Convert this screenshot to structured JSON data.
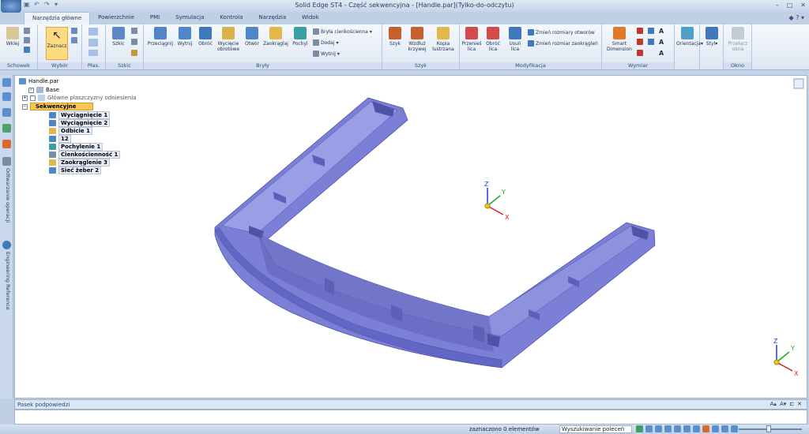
{
  "window": {
    "title": "Solid Edge ST4 - Część sekwencyjna - [Handle.par](Tylko-do-odczytu)",
    "controls": [
      "–",
      "□",
      "✕"
    ]
  },
  "tabs": [
    {
      "label": "Narzędzia główne",
      "active": true
    },
    {
      "label": "Powierzchnie"
    },
    {
      "label": "PMI"
    },
    {
      "label": "Symulacja"
    },
    {
      "label": "Kontrola"
    },
    {
      "label": "Narzędzia"
    },
    {
      "label": "Widok"
    }
  ],
  "ribbon": {
    "groups": {
      "schowek": "Schowek",
      "wybor": "Wybór",
      "plas": "Płas.",
      "szkic": "Szkic",
      "bryly": "Bryły",
      "szyk": "Szyk",
      "modyfikacja": "Modyfikacja",
      "wymiar": "Wymiar",
      "okno": "Okno"
    },
    "buttons": {
      "wklej": "Wklej",
      "zaznacz": "Zaznacz",
      "szkic": "Szkic",
      "przeciagnij": "Przeciągnij",
      "wytnij": "Wytnij",
      "obroc": "Obróć",
      "wyciecie_obrotowe": "Wycięcie obrotowe",
      "otwor": "Otwór",
      "zaokraglaj": "Zaokrąglaj",
      "pochyl": "Pochyl",
      "bryla_cienkoscienna": "Bryła cienkościenna",
      "dodaj": "Dodaj",
      "wytnij_small": "Wytnij",
      "szyk": "Szyk",
      "wzdluz_krzywej": "Wzdłuż krzywej",
      "kopia_lustrzana": "Kopia lustrzana",
      "przenies_lica": "Przenieś lica",
      "obroc_lica": "Obróć lica",
      "usun_lica": "Usuń lica",
      "zmien_rozmiary_otworow": "Zmień rozmiary otworów",
      "zmien_rozmiar_zaokraglen": "Zmień rozmiar zaokrągleń",
      "smart_dimension": "Smart Dimension",
      "orientacja": "Orientacja",
      "styl": "Styl",
      "przelacz_okna": "Przełącz okna"
    }
  },
  "nav_tabs": {
    "odtwarzanie": "Odtwarzanie operacji",
    "engineering": "Engineering Reference"
  },
  "tree": {
    "root": "Handle.par",
    "base": "Base",
    "plaszczyzny": "Główne płaszczyzny odniesienia",
    "sekwencyjne": "Sekwencyjne",
    "features": [
      "Wyciągnięcie 1",
      "Wyciągnięcie 2",
      "Odbicie 1",
      "12",
      "Pochylenie 1",
      "Cienkościenność 1",
      "Zaokrąglenie 3",
      "Sieć żeber 2"
    ]
  },
  "triad": {
    "x": "X",
    "y": "Y",
    "z": "Z"
  },
  "hint": {
    "label": "Pasek podpowiedzi"
  },
  "status": {
    "selection": "zaznaczono 0 elementów",
    "search_placeholder": "Wyszukiwanie poleceń"
  },
  "colors": {
    "part": "#7b7fd6",
    "part_dark": "#5c60b8",
    "part_light": "#9a9ee6",
    "accent": "#f7c65b"
  }
}
